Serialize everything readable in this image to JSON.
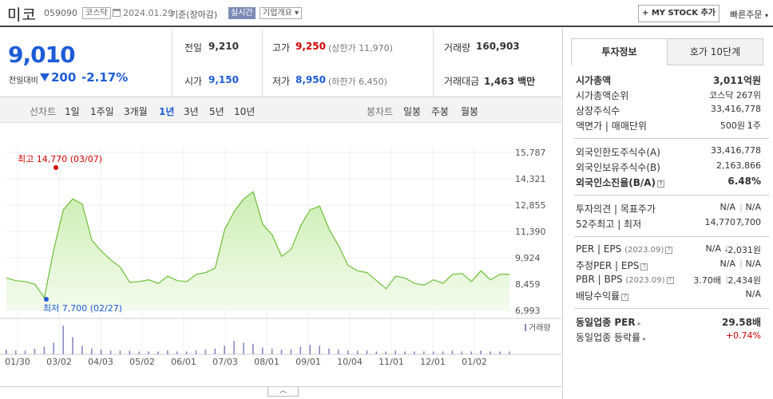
{
  "header": {
    "name": "미코",
    "code": "059090",
    "market": "코스닥",
    "date": "2024.01.29",
    "basis": "기준(장마감)",
    "live_label": "실시간",
    "overview_label": "기업개요",
    "mystock_label": "+ MY STOCK 추가",
    "quick_order_label": "빠른주문"
  },
  "price": {
    "current": "9,010",
    "vs_label": "전일대비",
    "change": "200",
    "change_rate": "-2.17%"
  },
  "quote": {
    "prev_label": "전일",
    "prev": "9,210",
    "high_label": "고가",
    "high": "9,250",
    "upper_limit": "(상한가 11,970)",
    "volume_label": "거래량",
    "volume": "160,903",
    "open_label": "시가",
    "open": "9,150",
    "low_label": "저가",
    "low": "8,950",
    "lower_limit": "(하한가 6,450)",
    "amount_label": "거래대금",
    "amount": "1,463 백만"
  },
  "period_tabs": {
    "line_label": "선차트",
    "items": [
      "1일",
      "1주일",
      "3개월",
      "1년",
      "3년",
      "5년",
      "10년"
    ],
    "active": "1년",
    "candle_label": "봉차트",
    "candles": [
      "일봉",
      "주봉",
      "월봉"
    ]
  },
  "chart_data": {
    "type": "area",
    "title": "",
    "xlabel": "",
    "ylabel": "",
    "y_ticks": [
      "15,787",
      "14,321",
      "12,855",
      "11,390",
      "9,924",
      "8,459",
      "6,993"
    ],
    "ylim": [
      6993,
      15787
    ],
    "x_ticks": [
      "01/30",
      "03/02",
      "04/03",
      "05/02",
      "06/01",
      "07/03",
      "08/01",
      "09/01",
      "10/04",
      "11/01",
      "12/01",
      "01/02"
    ],
    "max_label": "최고 14,770 (03/07)",
    "min_label": "최저 7,700 (02/27)",
    "volume_label": "거래량",
    "series": [
      {
        "name": "",
        "x": [
          "01/30",
          "02/05",
          "02/12",
          "02/19",
          "02/27",
          "03/02",
          "03/07",
          "03/13",
          "03/20",
          "03/27",
          "04/03",
          "04/10",
          "04/17",
          "04/24",
          "05/02",
          "05/09",
          "05/16",
          "05/23",
          "06/01",
          "06/08",
          "06/15",
          "06/22",
          "06/29",
          "07/03",
          "07/06",
          "07/13",
          "07/20",
          "07/27",
          "08/01",
          "08/08",
          "08/16",
          "08/23",
          "09/01",
          "09/05",
          "09/12",
          "09/19",
          "09/26",
          "10/04",
          "10/11",
          "10/18",
          "10/25",
          "11/01",
          "11/08",
          "11/15",
          "11/22",
          "12/01",
          "12/08",
          "12/15",
          "12/22",
          "01/02",
          "01/09",
          "01/16",
          "01/23",
          "01/29"
        ],
        "y": [
          8800,
          8650,
          8600,
          8450,
          7700,
          10400,
          12600,
          13200,
          12900,
          10900,
          10300,
          9800,
          9400,
          8550,
          8600,
          8700,
          8500,
          8900,
          8650,
          8600,
          9000,
          9100,
          9350,
          11500,
          12500,
          13200,
          13600,
          11800,
          11200,
          10000,
          10400,
          11700,
          12600,
          12800,
          11500,
          10600,
          9500,
          9200,
          9100,
          8650,
          8200,
          8900,
          8800,
          8500,
          8400,
          8700,
          8500,
          9000,
          9050,
          8600,
          9200,
          8700,
          9000,
          9010
        ]
      }
    ],
    "volume": [
      5,
      4,
      4,
      6,
      8,
      12,
      30,
      18,
      9,
      6,
      5,
      4,
      4,
      4,
      3,
      3,
      3,
      4,
      3,
      3,
      4,
      5,
      6,
      9,
      14,
      12,
      11,
      7,
      6,
      5,
      5,
      8,
      10,
      9,
      6,
      5,
      4,
      4,
      4,
      3,
      3,
      4,
      3,
      3,
      3,
      3,
      3,
      4,
      3,
      3,
      4,
      3,
      3,
      3
    ]
  },
  "right_panel": {
    "tabs": [
      "투자정보",
      "호가 10단계"
    ],
    "active_tab": "투자정보",
    "market_cap_label": "시가총액",
    "market_cap": "3,011억원",
    "cap_rank_label": "시가총액순위",
    "cap_rank": "코스닥 267위",
    "shares_label": "상장주식수",
    "shares": "33,416,778",
    "par_label": "액면가 | 매매단위",
    "par": "500원",
    "unit": "1주",
    "foreign_limit_label": "외국인한도주식수(A)",
    "foreign_limit": "33,416,778",
    "foreign_hold_label": "외국인보유주식수(B)",
    "foreign_hold": "2,163,866",
    "foreign_rate_label": "외국인소진율(B/A)",
    "foreign_rate": "6.48%",
    "opinion_label": "투자의견 | 목표주가",
    "opinion": "N/A",
    "target": "N/A",
    "w52_label": "52주최고 | 최저",
    "w52_high": "14,770",
    "w52_low": "7,700",
    "per_label": "PER | EPS",
    "per_year": "(2023.09)",
    "per": "N/A",
    "eps": "-2,031원",
    "est_per_label": "추정PER | EPS",
    "est_per": "N/A",
    "est_eps": "N/A",
    "pbr_label": "PBR | BPS",
    "pbr_year": "(2023.09)",
    "pbr": "3.70배",
    "bps": "2,434원",
    "div_label": "배당수익률",
    "div": "N/A",
    "ind_per_label": "동일업종 PER",
    "ind_per": "29.58배",
    "ind_rate_label": "동일업종 등락률",
    "ind_rate": "+0.74%"
  }
}
